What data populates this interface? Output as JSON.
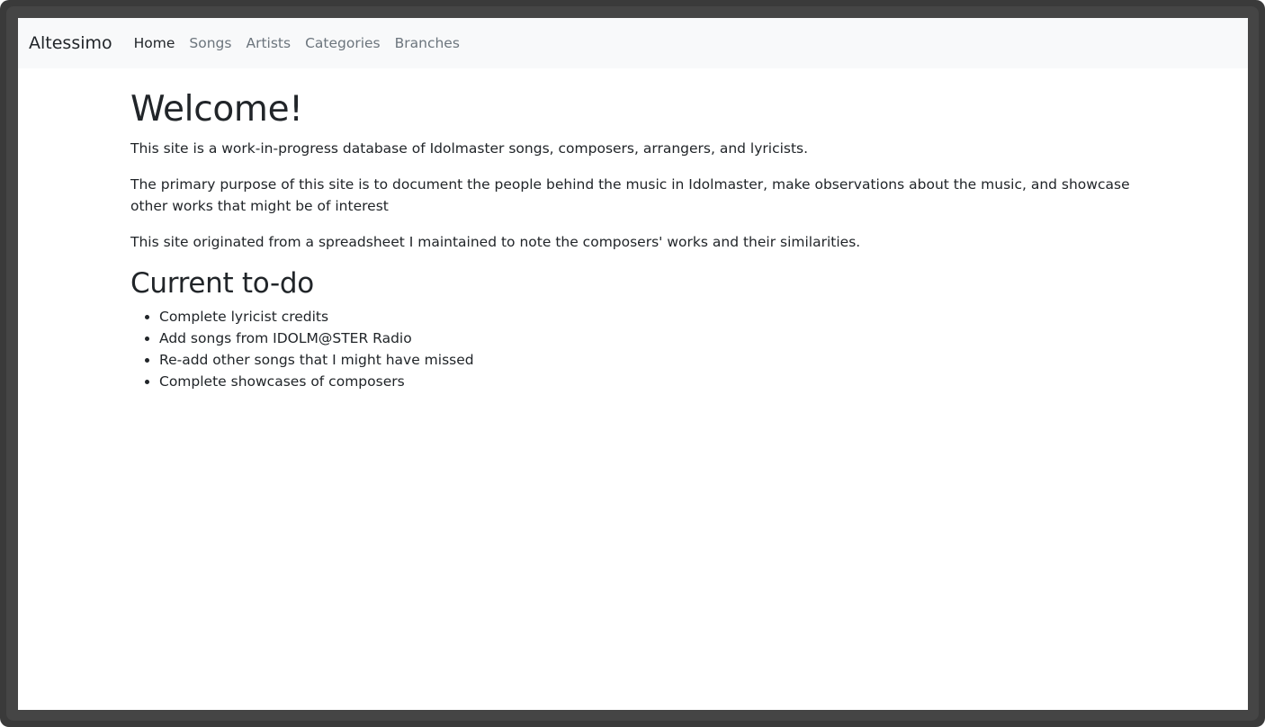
{
  "navbar": {
    "brand": "Altessimo",
    "links": [
      {
        "label": "Home",
        "active": true
      },
      {
        "label": "Songs",
        "active": false
      },
      {
        "label": "Artists",
        "active": false
      },
      {
        "label": "Categories",
        "active": false
      },
      {
        "label": "Branches",
        "active": false
      }
    ]
  },
  "main": {
    "heading": "Welcome!",
    "paragraphs": [
      "This site is a work-in-progress database of Idolmaster songs, composers, arrangers, and lyricists.",
      "The primary purpose of this site is to document the people behind the music in Idolmaster, make observations about the music, and showcase other works that might be of interest",
      "This site originated from a spreadsheet I maintained to note the composers' works and their similarities."
    ],
    "todo_heading": "Current to-do",
    "todo_items": [
      "Complete lyricist credits",
      "Add songs from IDOLM@STER Radio",
      "Re-add other songs that I might have missed",
      "Complete showcases of composers"
    ]
  },
  "colors": {
    "navbar_bg": "#f8f9fa",
    "text": "#212529",
    "nav_muted": "#6c757d",
    "window_frame": "#3a3a3a"
  }
}
